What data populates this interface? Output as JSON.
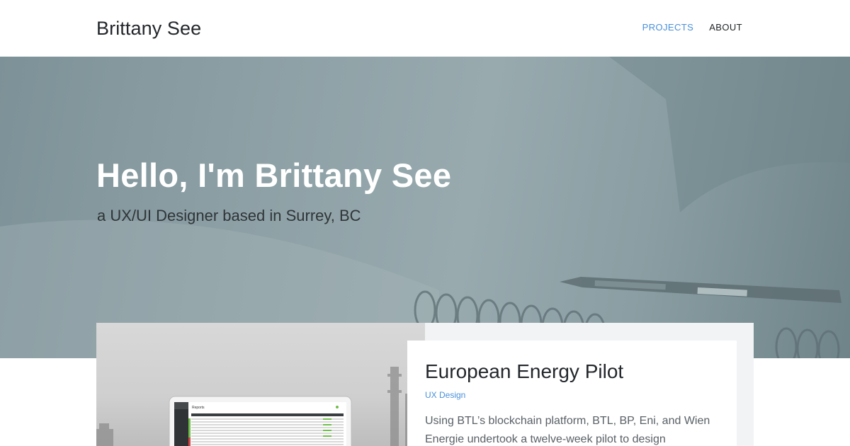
{
  "header": {
    "brand": "Brittany See",
    "nav": [
      {
        "label": "PROJECTS",
        "active": true
      },
      {
        "label": "ABOUT",
        "active": false
      }
    ]
  },
  "hero": {
    "title": "Hello, I'm Brittany See",
    "subtitle": "a UX/UI Designer based in Surrey, BC"
  },
  "project": {
    "title": "European Energy Pilot",
    "tag": "UX Design",
    "description": "Using BTL’s blockchain platform, BTL, BP, Eni, and Wien Energie undertook a twelve-week pilot to design",
    "laptop_screen_title": "Reports"
  },
  "colors": {
    "accent": "#4a90d9",
    "hero_overlay": "#8a9ea3"
  }
}
